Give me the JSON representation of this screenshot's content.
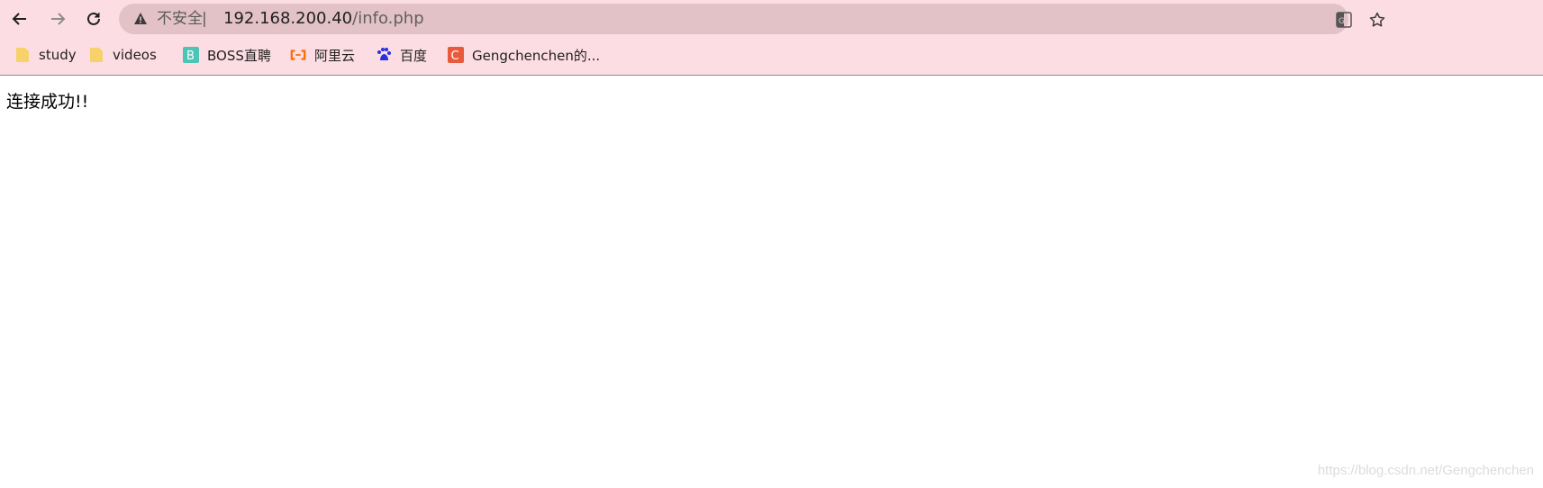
{
  "browser": {
    "security_label": "不安全",
    "separator": "|",
    "url_host": "192.168.200.40",
    "url_path": "/info.php",
    "icons": {
      "back": "back-arrow-icon",
      "forward": "forward-arrow-icon",
      "reload": "reload-icon",
      "warning": "warning-icon",
      "translate": "translate-icon",
      "bookmark_star": "star-icon"
    }
  },
  "bookmarks": [
    {
      "label": "study",
      "icon": "folder-icon",
      "color": "#f7d26b"
    },
    {
      "label": "videos",
      "icon": "folder-icon",
      "color": "#f7d26b"
    },
    {
      "label": "BOSS直聘",
      "icon": "boss-icon",
      "color": "#4cc4b6"
    },
    {
      "label": "阿里云",
      "icon": "aliyun-icon",
      "color": "#ff6a00"
    },
    {
      "label": "百度",
      "icon": "baidu-icon",
      "color": "#2932e1"
    },
    {
      "label": "Gengchenchen的...",
      "icon": "csdn-icon",
      "color": "#e95a3c"
    }
  ],
  "page": {
    "message": "连接成功!!",
    "watermark": "https://blog.csdn.net/Gengchenchen"
  },
  "colors": {
    "toolbar_bg": "#fddde4",
    "omnibox_bg": "#e3c2c7"
  }
}
